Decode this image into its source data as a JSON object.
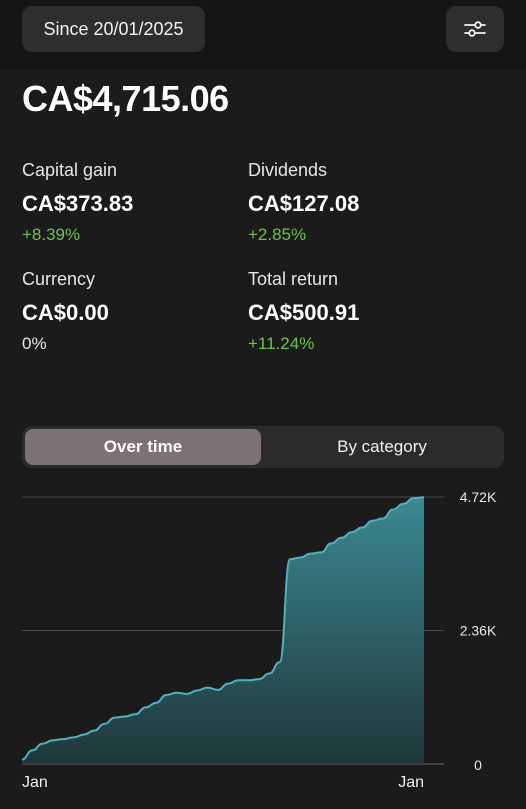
{
  "header": {
    "since_label": "Since 20/01/2025",
    "filter_icon": "sliders-icon"
  },
  "summary": {
    "total_value": "CA$4,715.06",
    "capital_gain": {
      "label": "Capital gain",
      "value": "CA$373.83",
      "pct": "+8.39%"
    },
    "dividends": {
      "label": "Dividends",
      "value": "CA$127.08",
      "pct": "+2.85%"
    },
    "currency": {
      "label": "Currency",
      "value": "CA$0.00",
      "pct": "0%"
    },
    "total_return": {
      "label": "Total return",
      "value": "CA$500.91",
      "pct": "+11.24%"
    }
  },
  "segmented": {
    "options": [
      "Over time",
      "By category"
    ],
    "selected": "Over time"
  },
  "colors": {
    "positive": "#6cc24a",
    "chart_line": "#4fb3bf",
    "background": "#1c1b1c"
  },
  "chart_data": {
    "type": "area",
    "x_tick_labels": [
      "Jan",
      "Jan"
    ],
    "y_tick_labels": [
      "0",
      "2.36K",
      "4.72K"
    ],
    "ylim": [
      0,
      4720
    ],
    "grid": true,
    "series": [
      {
        "values": [
          80,
          240,
          360,
          420,
          440,
          470,
          520,
          590,
          710,
          820,
          840,
          880,
          1000,
          1080,
          1220,
          1260,
          1240,
          1300,
          1350,
          1310,
          1420,
          1480,
          1480,
          1500,
          1600,
          1800,
          3620,
          3650,
          3720,
          3740,
          3900,
          4000,
          4100,
          4180,
          4300,
          4340,
          4500,
          4600,
          4700,
          4715
        ]
      }
    ]
  }
}
